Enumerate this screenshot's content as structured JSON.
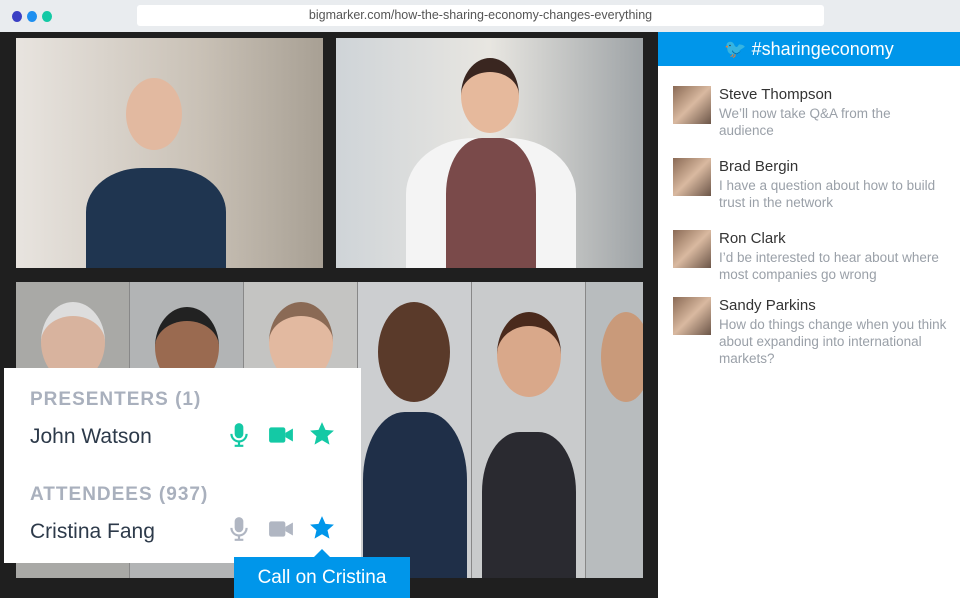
{
  "browser": {
    "url": "bigmarker.com/how-the-sharing-economy-changes-everything",
    "dots": [
      "#3a3fc4",
      "#1e8ff0",
      "#14c9a5"
    ]
  },
  "sidebar": {
    "hashtag": "#sharingeconomy",
    "messages": [
      {
        "name": "Steve Thompson",
        "text": "We’ll now take Q&A from the audience"
      },
      {
        "name": "Brad Bergin",
        "text": "I have a question about how to build trust in the network"
      },
      {
        "name": "Ron Clark",
        "text": "I’d be interested to hear about where most companies go wrong"
      },
      {
        "name": "Sandy Parkins",
        "text": "How do things change when you think about expanding into international markets?"
      }
    ]
  },
  "panel": {
    "presenters_label": "PRESENTERS (1)",
    "presenter": "John Watson",
    "attendees_label": "ATTENDEES (937)",
    "attendee": "Cristina Fang",
    "tooltip": "Call on Cristina"
  },
  "colors": {
    "accent": "#0096ea",
    "active": "#14c9a5",
    "inactive": "#b0b6c2"
  }
}
